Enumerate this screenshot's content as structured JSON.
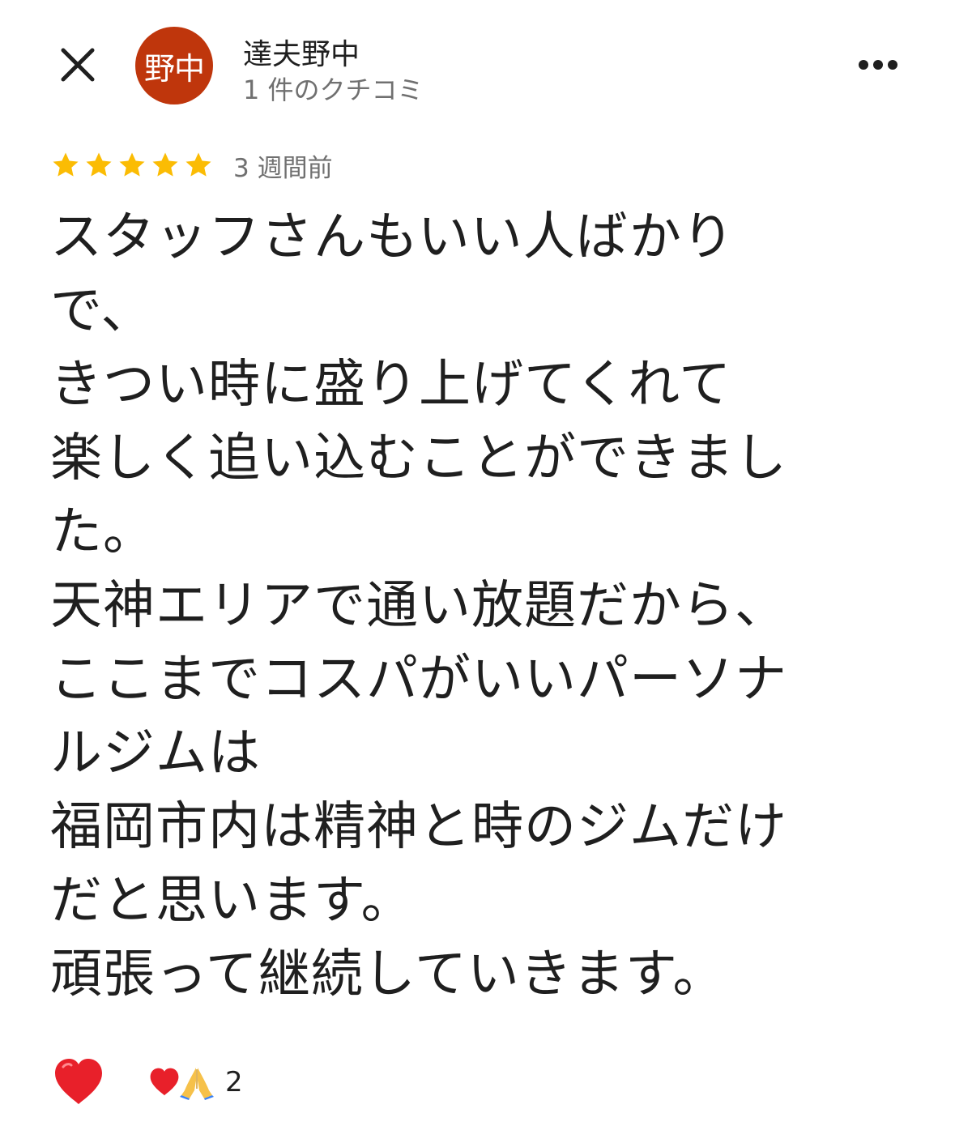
{
  "header": {
    "close_icon": "close-icon",
    "avatar_text": "野中",
    "avatar_color": "#bf360c",
    "reviewer_name": "達夫野中",
    "review_count": "1 件のクチコミ",
    "more_icon": "more-horizontal-icon"
  },
  "review": {
    "rating": 5,
    "rating_max": 5,
    "star_color": "#fbbc04",
    "timestamp": "3 週間前",
    "lines": [
      "スタッフさんもいい人ばかり",
      "で、",
      "きつい時に盛り上げてくれて",
      "楽しく追い込むことができまし",
      "た。",
      "天神エリアで通い放題だから、",
      "ここまでコスパがいいパーソナ",
      "ルジムは",
      "福岡市内は精神と時のジムだけ",
      "だと思います。",
      "頑張って継続していきます。"
    ]
  },
  "reactions": {
    "react_icon": "heart-icon",
    "summary_icons": [
      "heart-icon",
      "pray-icon"
    ],
    "count": "2"
  }
}
